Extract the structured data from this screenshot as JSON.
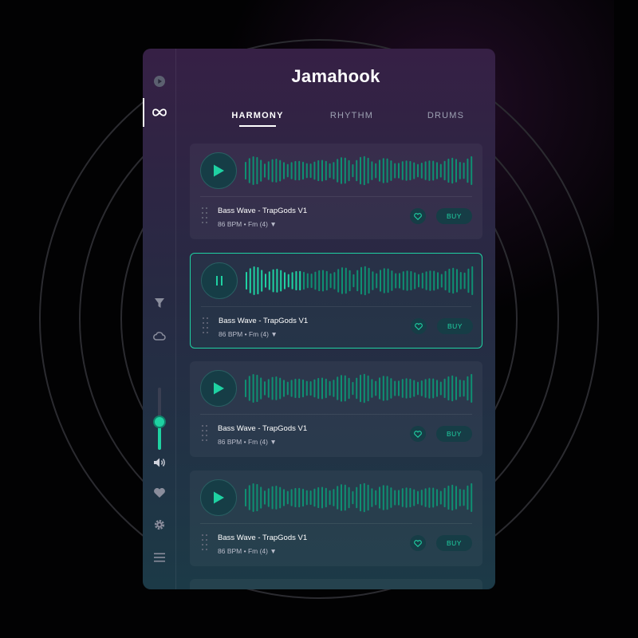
{
  "app": {
    "logo": "Jamahook"
  },
  "colors": {
    "accent": "#1fd1a2",
    "bg_top": "#362045",
    "bg_bottom": "#1c3a47"
  },
  "sidebar": {
    "top_items": [
      {
        "icon": "play-circle-icon",
        "active": false
      },
      {
        "icon": "infinity-icon",
        "active": true
      }
    ],
    "middle_items": [
      {
        "icon": "filter-icon"
      },
      {
        "icon": "cloud-icon"
      }
    ],
    "volume_level": 0.45,
    "bottom_items": [
      {
        "icon": "speaker-icon"
      },
      {
        "icon": "heart-icon"
      },
      {
        "icon": "gear-icon"
      },
      {
        "icon": "menu-icon"
      }
    ]
  },
  "tabs": [
    {
      "label": "HARMONY",
      "selected": true
    },
    {
      "label": "RHYTHM",
      "selected": false
    },
    {
      "label": "DRUMS",
      "selected": false
    }
  ],
  "tracks": [
    {
      "title": "Bass Wave - TrapGods V1",
      "bpm": "86 BPM",
      "key": "Fm (4)",
      "buy_label": "BUY",
      "state": "paused",
      "progress": 0
    },
    {
      "title": "Bass Wave - TrapGods V1",
      "bpm": "86 BPM",
      "key": "Fm (4)",
      "buy_label": "BUY",
      "state": "playing",
      "progress": 0.25
    },
    {
      "title": "Bass Wave - TrapGods V1",
      "bpm": "86 BPM",
      "key": "Fm (4)",
      "buy_label": "BUY",
      "state": "paused",
      "progress": 0
    },
    {
      "title": "Bass Wave - TrapGods V1",
      "bpm": "86 BPM",
      "key": "Fm (4)",
      "buy_label": "BUY",
      "state": "paused",
      "progress": 0
    }
  ]
}
